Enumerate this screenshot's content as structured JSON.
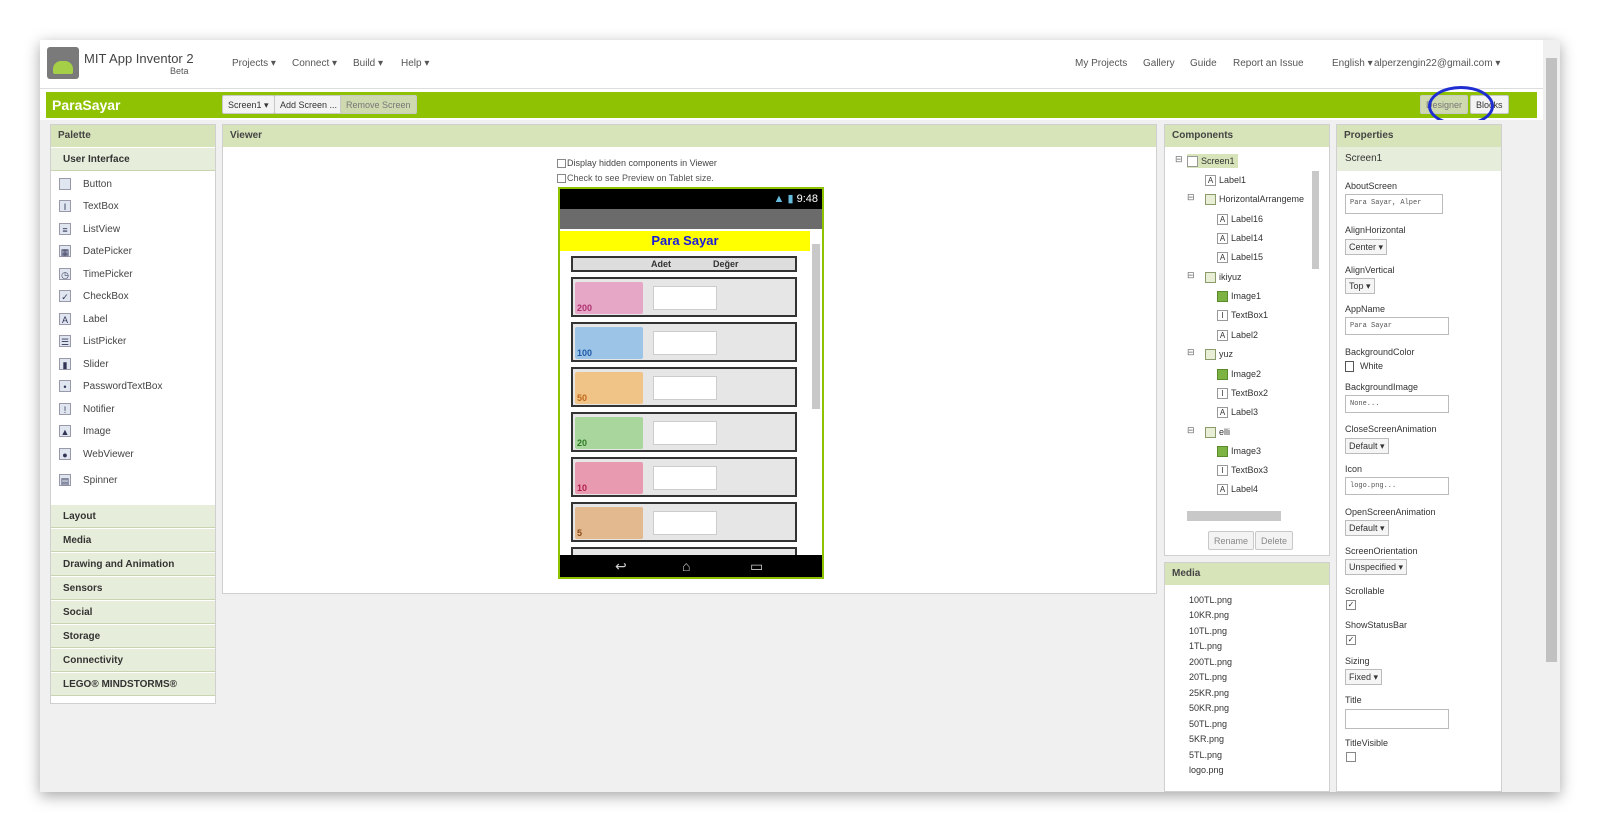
{
  "top": {
    "brand": "MIT App Inventor 2",
    "beta": "Beta",
    "menus": [
      "Projects ▾",
      "Connect ▾",
      "Build ▾",
      "Help ▾"
    ],
    "right": [
      "My Projects",
      "Gallery",
      "Guide",
      "Report an Issue",
      "English ▾",
      "alperzengin22@gmail.com ▾"
    ]
  },
  "bar": {
    "project": "ParaSayar",
    "screen": "Screen1 ▾",
    "add": "Add Screen ...",
    "remove": "Remove Screen",
    "designer": "Designer",
    "blocks": "Blocks"
  },
  "palette": {
    "title": "Palette",
    "section": "User Interface",
    "items": [
      "Button",
      "TextBox",
      "ListView",
      "DatePicker",
      "TimePicker",
      "CheckBox",
      "Label",
      "ListPicker",
      "Slider",
      "PasswordTextBox",
      "Notifier",
      "Image",
      "WebViewer",
      "Spinner"
    ],
    "categories": [
      "Layout",
      "Media",
      "Drawing and Animation",
      "Sensors",
      "Social",
      "Storage",
      "Connectivity",
      "LEGO® MINDSTORMS®"
    ]
  },
  "viewer": {
    "title": "Viewer",
    "hidden": "Display hidden components in Viewer",
    "tablet": "Check to see Preview on Tablet size.",
    "time": "9:48",
    "app_title": "Para Sayar",
    "col1": "Adet",
    "col2": "Değer",
    "notes": [
      "200",
      "100",
      "50",
      "20",
      "10",
      "5"
    ]
  },
  "components": {
    "title": "Components",
    "items": [
      "Screen1",
      "Label1",
      "HorizontalArrangeme",
      "Label16",
      "Label14",
      "Label15",
      "ikiyuz",
      "Image1",
      "TextBox1",
      "Label2",
      "yuz",
      "Image2",
      "TextBox2",
      "Label3",
      "elli",
      "Image3",
      "TextBox3",
      "Label4"
    ],
    "rename": "Rename",
    "delete": "Delete"
  },
  "media": {
    "title": "Media",
    "items": [
      "100TL.png",
      "10KR.png",
      "10TL.png",
      "1TL.png",
      "200TL.png",
      "20TL.png",
      "25KR.png",
      "50KR.png",
      "50TL.png",
      "5KR.png",
      "5TL.png",
      "logo.png"
    ]
  },
  "properties": {
    "title": "Properties",
    "screen": "Screen1",
    "about_label": "AboutScreen",
    "about_value": "Para Sayar, Alper",
    "alignh_label": "AlignHorizontal",
    "alignh_value": "Center ▾",
    "alignv_label": "AlignVertical",
    "alignv_value": "Top ▾",
    "appname_label": "AppName",
    "appname_value": "Para Sayar",
    "bgcolor_label": "BackgroundColor",
    "bgcolor_value": "White",
    "bgimage_label": "BackgroundImage",
    "bgimage_value": "None...",
    "close_label": "CloseScreenAnimation",
    "close_value": "Default ▾",
    "icon_label": "Icon",
    "icon_value": "logo.png...",
    "open_label": "OpenScreenAnimation",
    "open_value": "Default ▾",
    "orient_label": "ScreenOrientation",
    "orient_value": "Unspecified ▾",
    "scroll_label": "Scrollable",
    "status_label": "ShowStatusBar",
    "sizing_label": "Sizing",
    "sizing_value": "Fixed ▾",
    "title_label": "Title",
    "titlevis_label": "TitleVisible"
  }
}
